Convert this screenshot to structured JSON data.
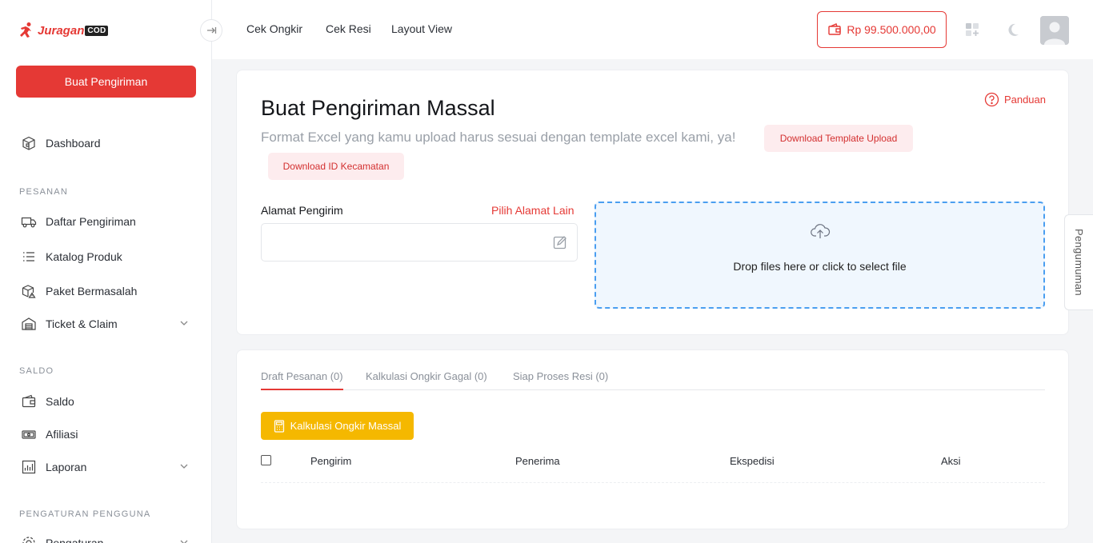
{
  "app": {
    "brand": "Juragan",
    "brand_suffix": "COD"
  },
  "sidebar": {
    "create_button": "Buat Pengiriman",
    "dashboard": "Dashboard",
    "sections": {
      "pesanan": "PESANAN",
      "saldo": "SALDO",
      "pengaturan": "PENGATURAN PENGGUNA"
    },
    "items": {
      "daftar_pengiriman": "Daftar Pengiriman",
      "katalog_produk": "Katalog Produk",
      "paket_bermasalah": "Paket Bermasalah",
      "ticket_claim": "Ticket & Claim",
      "saldo": "Saldo",
      "afiliasi": "Afiliasi",
      "laporan": "Laporan",
      "pengaturan": "Pengaturan"
    }
  },
  "topbar": {
    "links": [
      "Cek Ongkir",
      "Cek Resi",
      "Layout View"
    ],
    "balance": "Rp 99.500.000,00"
  },
  "main": {
    "title": "Buat Pengiriman Massal",
    "subtitle": "Format Excel yang kamu upload harus sesuai dengan template excel kami, ya!",
    "download_template": "Download Template Upload",
    "download_kecamatan": "Download ID Kecamatan",
    "guide": "Panduan",
    "sender_label": "Alamat Pengirim",
    "choose_address": "Pilih Alamat Lain",
    "dropzone_text": "Drop files here or click to select file",
    "announcement": "Pengumuman"
  },
  "orders": {
    "tabs": [
      "Draft Pesanan (0)",
      "Kalkulasi Ongkir Gagal (0)",
      "Siap Proses Resi (0)"
    ],
    "calc_button": "Kalkulasi Ongkir Massal",
    "columns": [
      "Pengirim",
      "Penerima",
      "Ekspedisi",
      "Aksi"
    ]
  },
  "colors": {
    "accent": "#e53935",
    "warning": "#f5b800",
    "dropzone_border": "#4a9ef0"
  }
}
